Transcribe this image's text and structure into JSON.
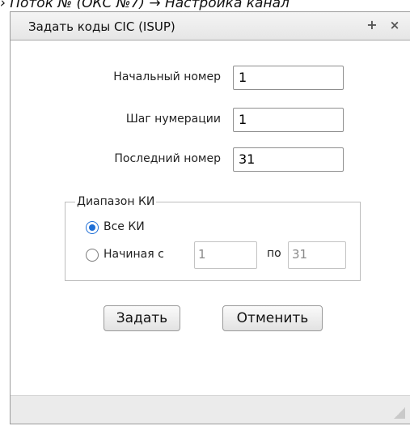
{
  "background": {
    "caption": "› Поток № (ОКС №7) → Настройка канал"
  },
  "dialog": {
    "title": "Задать коды CIC (ISUP)",
    "pin_icon": "plus-icon",
    "close_icon": "close-icon",
    "fields": {
      "start_label": "Начальный номер",
      "start_value": "1",
      "step_label": "Шаг нумерации",
      "step_value": "1",
      "last_label": "Последний номер",
      "last_value": "31"
    },
    "range": {
      "legend": "Диапазон КИ",
      "all_label": "Все КИ",
      "from_label": "Начиная с",
      "from_value": "1",
      "to_label": "по",
      "to_value": "31",
      "selected": "all"
    },
    "buttons": {
      "apply": "Задать",
      "cancel": "Отменить"
    },
    "accent_color": "#1f6fd6"
  }
}
